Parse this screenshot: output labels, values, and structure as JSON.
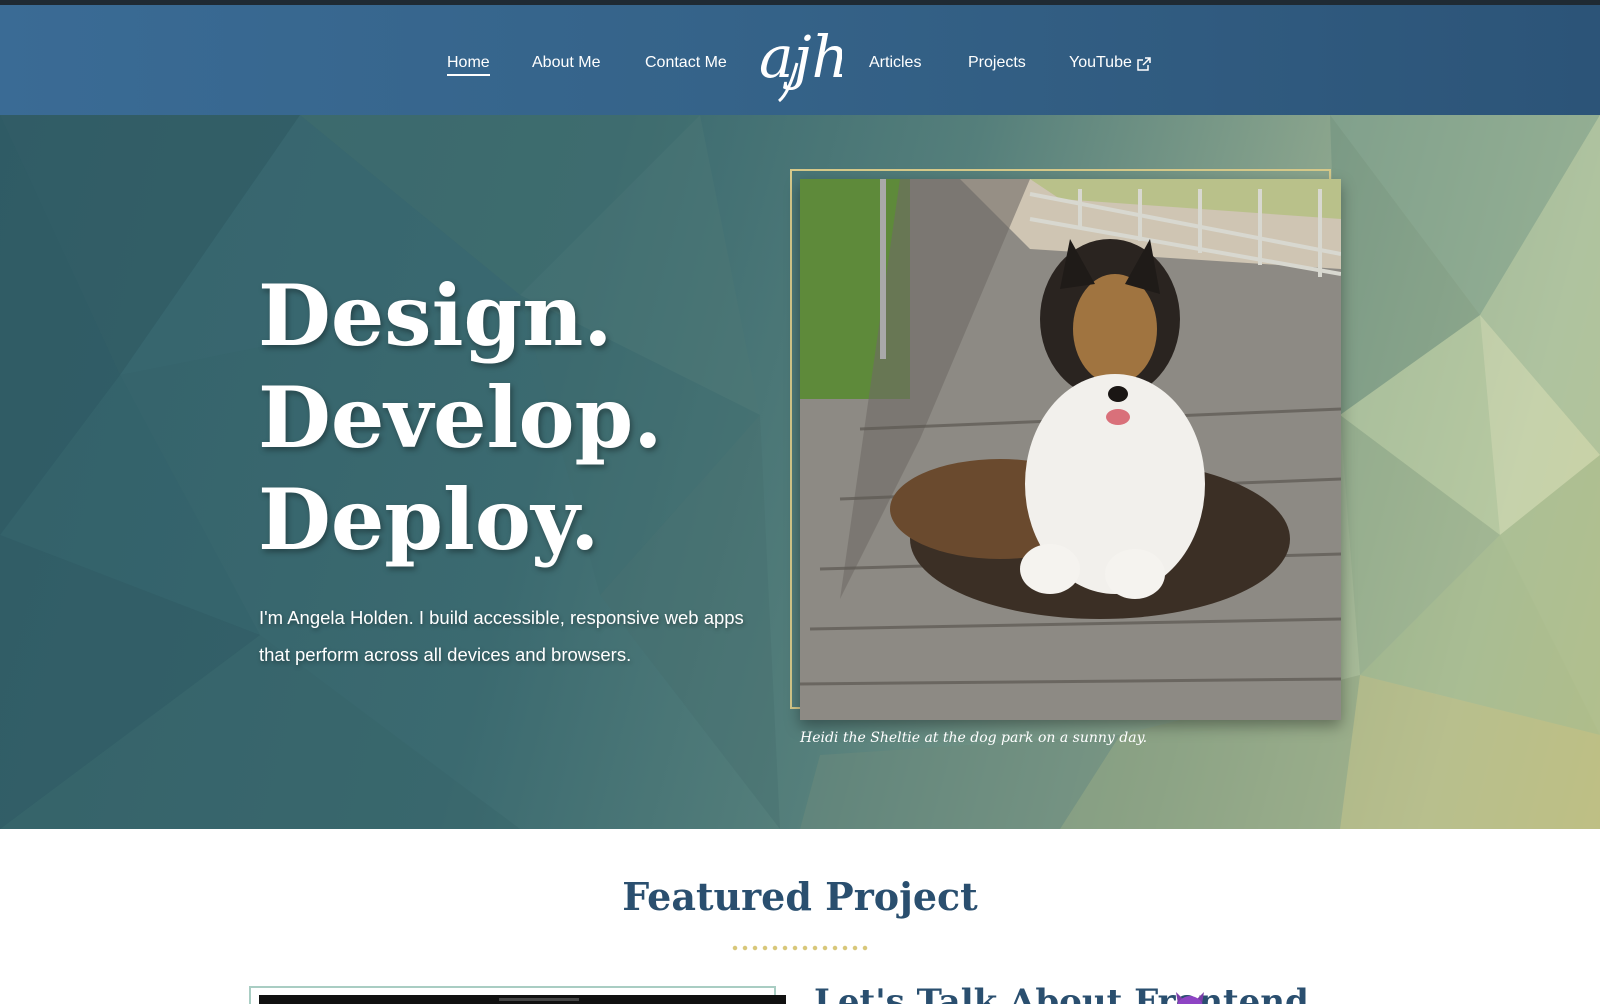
{
  "colors": {
    "header_bg": "#356389",
    "accent_gold": "#d6c98a",
    "heading_blue": "#2a4f6f",
    "frame_teal": "#a9cdc3"
  },
  "nav": {
    "items": [
      {
        "label": "Home",
        "active": true
      },
      {
        "label": "About Me",
        "active": false
      },
      {
        "label": "Contact Me",
        "active": false
      },
      {
        "label": "Articles",
        "active": false
      },
      {
        "label": "Projects",
        "active": false
      },
      {
        "label": "YouTube",
        "active": false,
        "icon": "external-link-icon"
      }
    ],
    "logo_text": "ajh"
  },
  "hero": {
    "headline": [
      "Design.",
      "Develop.",
      "Deploy."
    ],
    "intro_line1": "I'm Angela Holden. I build accessible, responsive web apps",
    "intro_line2": "that perform across all devices and browsers.",
    "photo_caption": "Heidi the Sheltie at the dog park on a sunny day."
  },
  "featured": {
    "title": "Featured Project",
    "project_title": "Let's Talk About Frontend",
    "project_icon": "purple-devil-emoji-icon"
  }
}
